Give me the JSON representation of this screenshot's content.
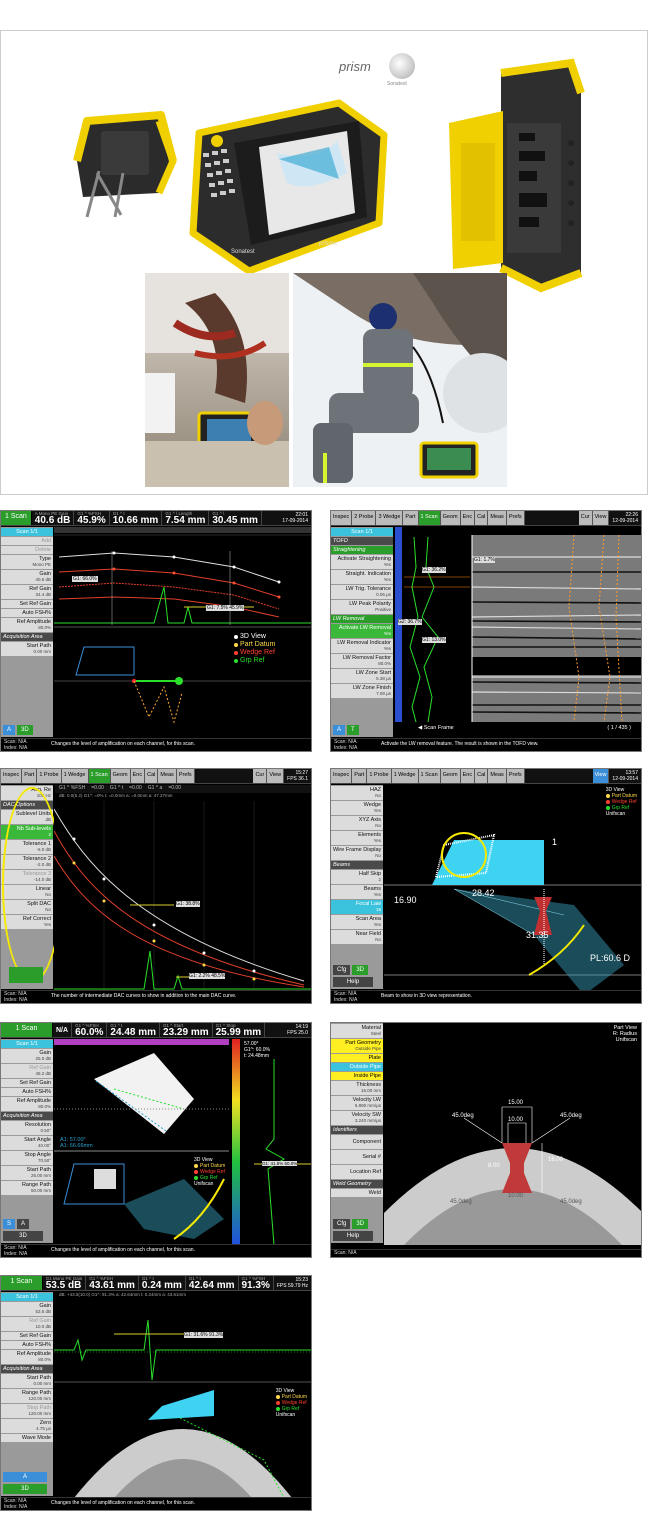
{
  "brand": {
    "logo": "prism",
    "maker": "Sonatest",
    "device_label": "prisma"
  },
  "colors": {
    "accent": "#2a9d2a",
    "device_yellow": "#f0d000",
    "cyan": "#3bc3dd"
  },
  "s1": {
    "scan_btn": "1 Scan",
    "scan_sel": "Scan 1/1",
    "m": [
      {
        "l": "A Mono PE Gain",
        "v": "40.6 dB"
      },
      {
        "l": "G1 ^ %FSH",
        "v": "45.9%"
      },
      {
        "l": "G1 ^ t",
        "v": "10.66 mm"
      },
      {
        "l": "G1 ^ \\ Length",
        "v": "7.54 mm"
      },
      {
        "l": "G1 ^ \\",
        "v": "30.45 mm"
      }
    ],
    "sub": "dB: +4.1/36.5J   G1^: 45.9%   t: 10.66mm   a: 28.52mm   a: 30.45mm",
    "time": "22:01",
    "date": "17-09-2014",
    "panel": [
      {
        "t": "Add",
        "dim": true
      },
      {
        "t": "Delete",
        "dim": true
      },
      {
        "t": "Type",
        "s": "Mono PE"
      },
      {
        "t": "Gain",
        "s": "40.6 dB"
      },
      {
        "t": "Ref Gain",
        "s": "34.4 dB"
      },
      {
        "t": "Set Ref Gain"
      },
      {
        "t": "Auto FSH%"
      },
      {
        "t": "Ref Amplitude",
        "s": "80.0%"
      },
      {
        "t": "Acquisition Area"
      },
      {
        "t": "Start Path",
        "s": "0.00 mm"
      }
    ],
    "gate_label": "G1: 7.5%  45.9%",
    "dac_label": "G1: 66.0%",
    "legend": [
      "3D View",
      "Part Datum",
      "Wedge Ref",
      "Grp Ref"
    ],
    "a_btn": "A",
    "d_btn": "3D",
    "scan": "N/A",
    "index": "N/A",
    "hint": "Changes the level of amplification on each channel, for this scan."
  },
  "s2": {
    "tabs": [
      "Inspec",
      "2 Probe",
      "3 Wedge",
      "Part",
      "1 Scan",
      "Geom",
      "Enc",
      "Cal",
      "Meas",
      "Prefs"
    ],
    "cur": "Cur",
    "view": "View",
    "time": "22:26",
    "date": "12-09-2014",
    "scan_sel": "Scan 1/1",
    "panel": [
      {
        "t": "TOFD",
        "hdr": true
      },
      {
        "t": "Straightening",
        "hdr": true
      },
      {
        "t": "Activate Straightening",
        "s": "Yes"
      },
      {
        "t": "Straight. Indication",
        "s": "Yes"
      },
      {
        "t": "LW Trig. Tolerance",
        "s": "0.05 µs"
      },
      {
        "t": "LW Peak Polarity",
        "s": "Positive"
      },
      {
        "t": "LW Removal",
        "hdr": true
      },
      {
        "t": "Activate LW Removal",
        "s": "Yes",
        "sel": true
      },
      {
        "t": "LW Removal Indicator",
        "s": "Yes"
      },
      {
        "t": "LW Removal Factor",
        "s": "80.0%"
      },
      {
        "t": "LW Zone Start",
        "s": "5.38 µs"
      },
      {
        "t": "LW Zone Finish",
        "s": "7.08 µs"
      }
    ],
    "frame": "Scan Frame",
    "count": "1 / 435",
    "a_btn": "A",
    "t_btn": "T",
    "scan": "N/A",
    "index": "N/A",
    "hint": "Activate the LW removal feature. The result is shown in the TOFD view.",
    "marks": [
      "G1: 1.7%",
      "G2: 36.7%",
      "G1: 36.2%",
      "G1: 13.0%"
    ]
  },
  "s3": {
    "tabs": [
      "Inspec",
      "Part",
      "1 Probe",
      "1 Wedge",
      "1 Scan",
      "Geom",
      "Enc",
      "Cal",
      "Meas",
      "Prefs"
    ],
    "cur": "Cur",
    "view": "View",
    "time": "15:27",
    "fps": "FPS 36.1",
    "m": [
      {
        "l": "G1 ^ %FSH",
        "v": "=0.00"
      },
      {
        "l": "G1 ^ t",
        "v": "=0.00"
      },
      {
        "l": "G1 ^ a",
        "v": "=0.00"
      }
    ],
    "sub": "dB: 0.0(5.2)   G1^: =0%   t: =0.0mm   a: =0.0mm   a: 47.27mm",
    "panel": [
      {
        "t": "Acq. Re",
        "s": "100 Hz"
      },
      {
        "t": "DAC Options",
        "hdr": true
      },
      {
        "t": "Sublevel Units",
        "s": "dB"
      },
      {
        "t": "Nb Sub-levels",
        "s": "2",
        "sel": true
      },
      {
        "t": "Tolerance 1",
        "s": "-6.0 dB"
      },
      {
        "t": "Tolerance 2",
        "s": "-2.0 dB"
      },
      {
        "t": "Tolerance 3",
        "s": "-14.0 dB",
        "dim": true
      },
      {
        "t": "Linear",
        "s": "No"
      },
      {
        "t": "Split DAC",
        "s": "No"
      },
      {
        "t": "Ref Correct",
        "s": "Yes"
      }
    ],
    "labels": [
      "G1: 38.8%",
      "G1: 2.2%  48.5%"
    ],
    "scan": "N/A",
    "index": "N/A",
    "hint": "The number of intermediate DAC curves to show in addition to the main DAC curve."
  },
  "s4": {
    "tabs": [
      "Inspec",
      "Part",
      "1 Probe",
      "1 Wedge",
      "1 Scan",
      "Geom",
      "Enc",
      "Cal",
      "Meas",
      "Prefs"
    ],
    "view": "View",
    "time": "13:57",
    "date": "12-09-2014",
    "panel": [
      {
        "t": "HAZ",
        "s": "No"
      },
      {
        "t": "Wedge",
        "s": "Yes"
      },
      {
        "t": "XYZ Axis",
        "s": "No"
      },
      {
        "t": "Elements",
        "s": "Yes"
      },
      {
        "t": "Wire Frame Display",
        "s": "No"
      },
      {
        "t": "Beams",
        "hdr": true
      },
      {
        "t": "Half Skip",
        "s": "2"
      },
      {
        "t": "Beams",
        "s": "Yes"
      },
      {
        "t": "Focal Law",
        "s": "18",
        "cyan": true
      },
      {
        "t": "Scan Area",
        "s": "Yes"
      },
      {
        "t": "Near Field",
        "s": "No"
      }
    ],
    "v1": "1",
    "v2": "28.42",
    "v3": "16.90",
    "v4": "31.35",
    "v5": "PL:60.6 D",
    "legend": [
      "3D View",
      "Part Datum",
      "Wedge Ref",
      "Grp Ref",
      "Unifscan"
    ],
    "cfg": "Cfg",
    "d3": "3D",
    "help": "Help",
    "scan": "N/A",
    "index": "N/A",
    "hint": "Beam to show in 3D view representation."
  },
  "s5": {
    "scan_btn": "1 Scan",
    "scan_sel": "Scan 1/1",
    "m": [
      {
        "l": "",
        "v": "N/A"
      },
      {
        "l": "G1 ^ %FSH",
        "v": "60.0%"
      },
      {
        "l": "G1 ^ t",
        "v": "24.48 mm"
      },
      {
        "l": "G1 ^ Start",
        "v": "23.29 mm"
      },
      {
        "l": "G1 ^ Stop",
        "v": "25.99 mm"
      }
    ],
    "time": "14:19",
    "fps": "FPS 25.0",
    "panel": [
      {
        "t": "Gain",
        "s": "25.0 dB"
      },
      {
        "t": "Ref Gain",
        "s": "45.2 dB",
        "dim": true
      },
      {
        "t": "Set Ref Gain"
      },
      {
        "t": "Auto FSH%"
      },
      {
        "t": "Ref Amplitude",
        "s": "80.0%"
      },
      {
        "t": "Acquisition Area",
        "hdr": true
      },
      {
        "t": "Resolution",
        "s": "0.50°"
      },
      {
        "t": "Start Angle",
        "s": "40.00°"
      },
      {
        "t": "Stop Angle",
        "s": "70.50°"
      },
      {
        "t": "Start Path",
        "s": "25.00 mm"
      },
      {
        "t": "Range Path",
        "s": "50.00 mm"
      }
    ],
    "side": "57.00°",
    "side2": "G1^: 60.0%",
    "side3": "t: 24.48mm",
    "a1": "A1: 57.00°",
    "a2": "A1: 66.66mm",
    "g1": "G1: 41.8%  60.0%",
    "legend": [
      "3D View",
      "Part Datum",
      "Wedge Ref",
      "Grp Ref",
      "Unifscan"
    ],
    "s_btn": "S",
    "a_btn": "A",
    "d_btn": "3D",
    "scan": "N/A",
    "index": "N/A",
    "hint": "Changes the level of amplification on each channel, for this scan."
  },
  "s6": {
    "panel": [
      {
        "t": "Material",
        "s": "Steel"
      },
      {
        "t": "Part Geometry",
        "s": "Outside Pipe",
        "yel": true
      },
      {
        "t": "Plate",
        "yel": true
      },
      {
        "t": "Outside Pipe",
        "cyan": true
      },
      {
        "t": "Inside Pipe",
        "yel": true
      },
      {
        "t": "Thickness",
        "s": "16.00 mm"
      },
      {
        "t": "Velocity LW",
        "s": "5.890 mm/µs"
      },
      {
        "t": "Velocity SW",
        "s": "3.240 mm/µs"
      },
      {
        "t": "Identifiers",
        "hdr": true
      },
      {
        "t": "Component"
      },
      {
        "t": "Serial #"
      },
      {
        "t": "Location Ref"
      },
      {
        "t": "Weld Geometry",
        "hdr": true
      },
      {
        "t": "Weld"
      }
    ],
    "top_right": [
      "Part View",
      "R: Radius",
      "Unifscan"
    ],
    "dims": {
      "top": "15.00",
      "mid": "10.00",
      "gap": "2.00",
      "left_ang": "45.0deg",
      "right_ang": "45.0deg",
      "left_h": "8.00",
      "right_h": "16.00",
      "bot": "10.00",
      "ll": "45.0deg",
      "lr": "45.0deg"
    },
    "cfg": "Cfg",
    "d3": "3D",
    "help": "Help",
    "scan": "N/A"
  },
  "s7": {
    "scan_btn": "1 Scan",
    "scan_sel": "Scan 1/1",
    "m": [
      {
        "l": "G1 Mono PE Gain",
        "v": "53.5 dB"
      },
      {
        "l": "G1 ^ %FSH",
        "v": "43.61 mm"
      },
      {
        "l": "G1 ^ t",
        "v": "0.24 mm"
      },
      {
        "l": "G1 ^ t",
        "v": "42.64 mm"
      },
      {
        "l": "G1 ^ %FSH",
        "v": "91.3%"
      }
    ],
    "time": "15:23",
    "fps": "FPS 59.79 Hz",
    "sub": "dB: +43.5(10.0)   G1^: 91.3%   a: 42.64mm   t: 0.24mm   a: 43.61mm",
    "panel": [
      {
        "t": "Gain",
        "s": "53.5 dB"
      },
      {
        "t": "Ref Gain",
        "s": "10.0 dB",
        "dim": true
      },
      {
        "t": "Set Ref Gain"
      },
      {
        "t": "Auto FSH%"
      },
      {
        "t": "Ref Amplitude",
        "s": "80.0%"
      },
      {
        "t": "Acquisition Area",
        "hdr": true
      },
      {
        "t": "Start Path",
        "s": "0.00 mm"
      },
      {
        "t": "Range Path",
        "s": "120.00 mm"
      },
      {
        "t": "Stop Path",
        "s": "120.00 mm",
        "dim": true
      },
      {
        "t": "Zero",
        "s": "4.75 µs"
      },
      {
        "t": "Wave Mode"
      }
    ],
    "g1": "G1: 31.6%  91.3%",
    "legend": [
      "3D View",
      "Part Datum",
      "Wedge Ref",
      "Grp Ref",
      "Unifscan"
    ],
    "a_btn": "A",
    "d_btn": "3D",
    "scan": "N/A",
    "index": "N/A",
    "hint": "Changes the level of amplification on each channel, for this scan."
  }
}
